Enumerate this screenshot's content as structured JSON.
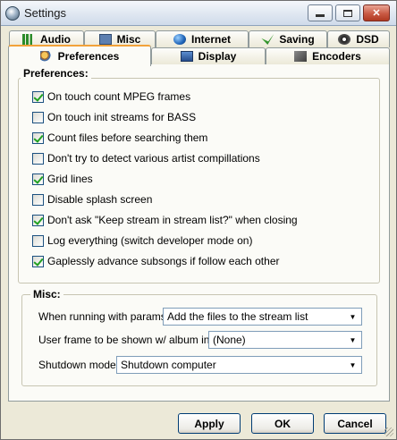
{
  "window": {
    "title": "Settings"
  },
  "tabs_top": [
    {
      "label": "Audio",
      "icon": "audio-icon"
    },
    {
      "label": "Misc",
      "icon": "misc-icon"
    },
    {
      "label": "Internet",
      "icon": "internet-icon"
    },
    {
      "label": "Saving",
      "icon": "saving-icon"
    },
    {
      "label": "DSD",
      "icon": "dsd-icon"
    }
  ],
  "tabs_bottom": [
    {
      "label": "Preferences",
      "icon": "preferences-icon",
      "active": true
    },
    {
      "label": "Display",
      "icon": "display-icon"
    },
    {
      "label": "Encoders",
      "icon": "encoders-icon"
    }
  ],
  "preferences": {
    "title": "Preferences:",
    "options": [
      {
        "label": "On touch count MPEG frames",
        "checked": true
      },
      {
        "label": "On touch init streams for BASS",
        "checked": false
      },
      {
        "label": "Count files before searching them",
        "checked": true
      },
      {
        "label": "Don't try to detect various artist compillations",
        "checked": false
      },
      {
        "label": "Grid lines",
        "checked": true
      },
      {
        "label": "Disable splash screen",
        "checked": false
      },
      {
        "label": "Don't ask \"Keep stream in stream list?\" when closing",
        "checked": true
      },
      {
        "label": "Log everything (switch developer mode on)",
        "checked": false
      },
      {
        "label": "Gaplessly advance subsongs if follow each other",
        "checked": true
      }
    ]
  },
  "misc": {
    "title": "Misc:",
    "params_label": "When running with params:",
    "params_value": "Add the files to the stream list",
    "frame_label": "User frame to be shown w/ album info:",
    "frame_value": "(None)",
    "shutdown_label": "Shutdown mode:",
    "shutdown_value": "Shutdown computer"
  },
  "buttons": {
    "apply": "Apply",
    "ok": "OK",
    "cancel": "Cancel"
  }
}
